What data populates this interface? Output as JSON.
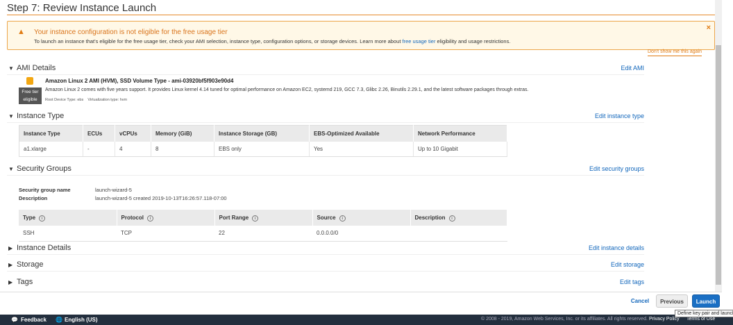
{
  "title": "Step 7: Review Instance Launch",
  "alert": {
    "heading": "Your instance configuration is not eligible for the free usage tier",
    "text_before": "To launch an instance that's eligible for the free usage tier, check your AMI selection, instance type, configuration options, or storage devices. Learn more about ",
    "link": "free usage tier",
    "text_after": " eligibility and usage restrictions.",
    "close": "×",
    "dont_show": "Don't show me this again"
  },
  "ami": {
    "section": "AMI Details",
    "edit": "Edit AMI",
    "name": "Amazon Linux 2 AMI (HVM), SSD Volume Type - ami-03920bf5f903e90d4",
    "description": "Amazon Linux 2 comes with five years support. It provides Linux kernel 4.14 tuned for optimal performance on Amazon EC2, systemd 219, GCC 7.3, Glibc 2.26, Binutils 2.29.1, and the latest software packages through extras.",
    "root": "Root Device Type: ebs",
    "virt": "Virtualization type: hvm",
    "badge1": "Free tier",
    "badge2": "eligible"
  },
  "instance_type": {
    "section": "Instance Type",
    "edit": "Edit instance type",
    "headers": [
      "Instance Type",
      "ECUs",
      "vCPUs",
      "Memory (GiB)",
      "Instance Storage (GB)",
      "EBS-Optimized Available",
      "Network Performance"
    ],
    "row": [
      "a1.xlarge",
      "-",
      "4",
      "8",
      "EBS only",
      "Yes",
      "Up to 10 Gigabit"
    ]
  },
  "security": {
    "section": "Security Groups",
    "edit": "Edit security groups",
    "name_label": "Security group name",
    "name": "launch-wizard-5",
    "desc_label": "Description",
    "desc": "launch-wizard-5 created 2019-10-13T16:26:57.118-07:00",
    "headers": [
      "Type",
      "Protocol",
      "Port Range",
      "Source",
      "Description"
    ],
    "row": [
      "SSH",
      "TCP",
      "22",
      "0.0.0.0/0",
      ""
    ]
  },
  "details": {
    "section": "Instance Details",
    "edit": "Edit instance details"
  },
  "storage": {
    "section": "Storage",
    "edit": "Edit storage"
  },
  "tags": {
    "section": "Tags",
    "edit": "Edit tags"
  },
  "buttons": {
    "cancel": "Cancel",
    "previous": "Previous",
    "launch": "Launch",
    "tooltip": "Define key pair and launch"
  },
  "footer": {
    "feedback": "Feedback",
    "language": "English (US)",
    "copyright": "© 2008 - 2019, Amazon Web Services, Inc. or its affiliates. All rights reserved.",
    "privacy": "Privacy Policy",
    "terms": "Terms of Use"
  }
}
